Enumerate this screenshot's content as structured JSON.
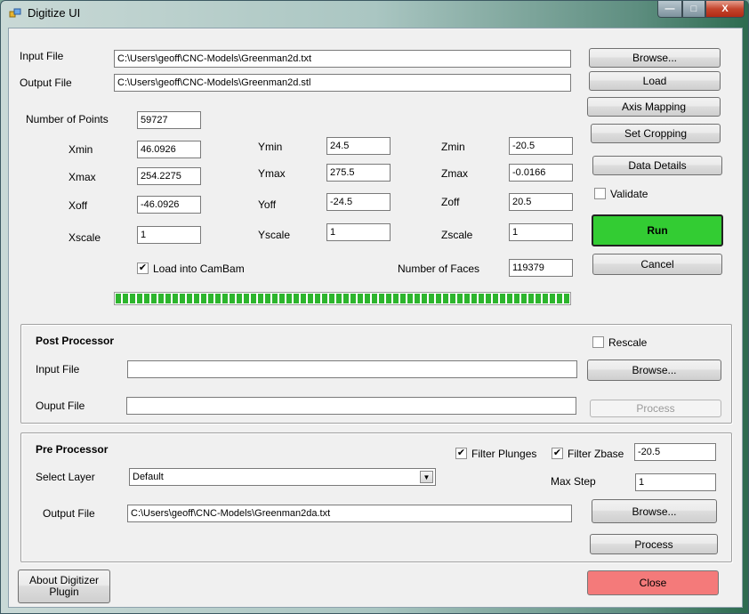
{
  "window": {
    "title": "Digitize UI",
    "caption_minimize": "—",
    "caption_maximize": "□",
    "caption_close": "X"
  },
  "files": {
    "input_label": "Input File",
    "input_value": "C:\\Users\\geoff\\CNC-Models\\Greenman2d.txt",
    "output_label": "Output File",
    "output_value": "C:\\Users\\geoff\\CNC-Models\\Greenman2d.stl"
  },
  "buttons": {
    "browse": "Browse...",
    "load": "Load",
    "axis_mapping": "Axis Mapping",
    "set_cropping": "Set Cropping",
    "data_details": "Data Details",
    "run": "Run",
    "cancel": "Cancel"
  },
  "validate_label": "Validate",
  "stats": {
    "points_label": "Number of Points",
    "points_value": "59727",
    "xmin_label": "Xmin",
    "xmin": "46.0926",
    "xmax_label": "Xmax",
    "xmax": "254.2275",
    "xoff_label": "Xoff",
    "xoff": "-46.0926",
    "xscale_label": "Xscale",
    "xscale": "1",
    "ymin_label": "Ymin",
    "ymin": "24.5",
    "ymax_label": "Ymax",
    "ymax": "275.5",
    "yoff_label": "Yoff",
    "yoff": "-24.5",
    "yscale_label": "Yscale",
    "yscale": "1",
    "zmin_label": "Zmin",
    "zmin": "-20.5",
    "zmax_label": "Zmax",
    "zmax": "-0.0166",
    "zoff_label": "Zoff",
    "zoff": "20.5",
    "zscale_label": "Zscale",
    "zscale": "1",
    "load_camBam_label": "Load into CamBam",
    "faces_label": "Number of Faces",
    "faces_value": "119379"
  },
  "progress": {
    "fraction": 1.0
  },
  "post": {
    "title": "Post Processor",
    "rescale_label": "Rescale",
    "input_label": "Input File",
    "input_value": "",
    "output_label": "Ouput File",
    "output_value": "",
    "browse": "Browse...",
    "process": "Process"
  },
  "pre": {
    "title": "Pre Processor",
    "filter_plunges_label": "Filter Plunges",
    "filter_zbase_label": "Filter Zbase",
    "zbase_value": "-20.5",
    "select_layer_label": "Select Layer",
    "select_layer_value": "Default",
    "max_step_label": "Max Step",
    "max_step_value": "1",
    "output_label": "Output File",
    "output_value": "C:\\Users\\geoff\\CNC-Models\\Greenman2da.txt",
    "browse": "Browse...",
    "process": "Process"
  },
  "footer": {
    "about": "About Digitizer Plugin",
    "close": "Close"
  },
  "check_mark": "✔",
  "combo_arrow": "▼"
}
